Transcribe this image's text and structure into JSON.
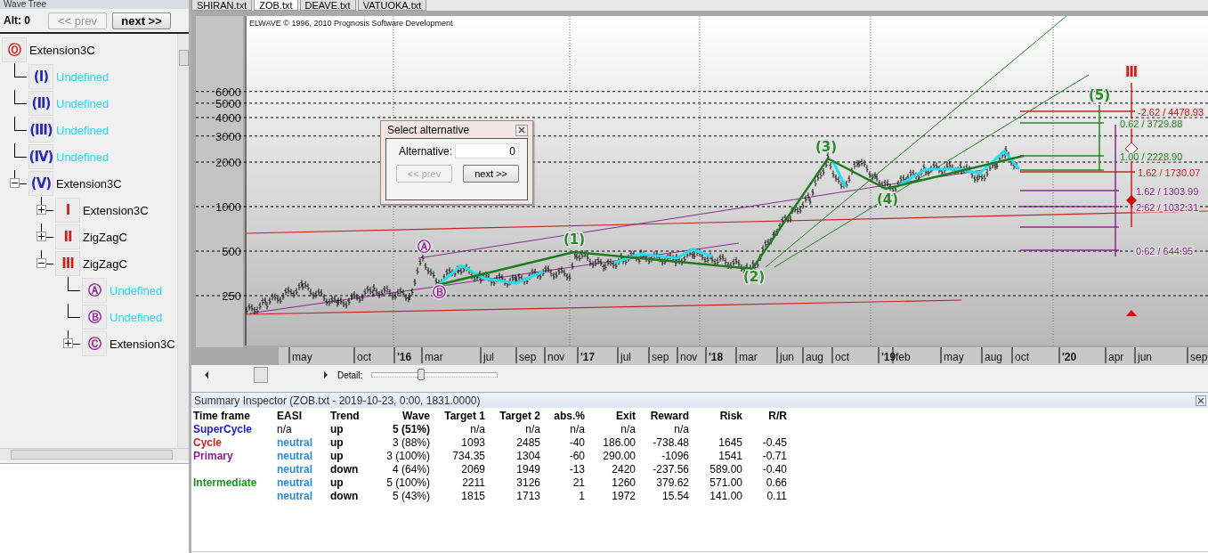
{
  "wave_tree": {
    "title": "Wave Tree",
    "alt_label": "Alt: 0",
    "prev_button": {
      "label": "<< prev",
      "disabled": true
    },
    "next_button": {
      "label": "next >>",
      "disabled": false
    },
    "nodes": [
      {
        "symbol": "Ⓞ",
        "color": "#cc2222",
        "label": "Extension3C",
        "defined": true,
        "children": [
          {
            "symbol": "(I)",
            "color": "#2a2ab0",
            "label": "Undefined",
            "defined": false
          },
          {
            "symbol": "(II)",
            "color": "#2a2ab0",
            "label": "Undefined",
            "defined": false
          },
          {
            "symbol": "(III)",
            "color": "#2a2ab0",
            "label": "Undefined",
            "defined": false
          },
          {
            "symbol": "(IV)",
            "color": "#2a2ab0",
            "label": "Undefined",
            "defined": false
          },
          {
            "symbol": "(V)",
            "color": "#2a2ab0",
            "label": "Extension3C",
            "defined": true,
            "expanded": true,
            "children": [
              {
                "symbol": "I",
                "color": "#cc2222",
                "label": "Extension3C",
                "defined": true,
                "expanded": false
              },
              {
                "symbol": "II",
                "color": "#cc2222",
                "label": "ZigZagC",
                "defined": true,
                "expanded": false
              },
              {
                "symbol": "III",
                "color": "#cc2222",
                "label": "ZigZagC",
                "defined": true,
                "expanded": true,
                "children": [
                  {
                    "symbol": "Ⓐ",
                    "color": "#9a2a9a",
                    "label": "Undefined",
                    "defined": false
                  },
                  {
                    "symbol": "Ⓑ",
                    "color": "#9a2a9a",
                    "label": "Undefined",
                    "defined": false
                  },
                  {
                    "symbol": "Ⓒ",
                    "color": "#9a2a9a",
                    "label": "Extension3C",
                    "defined": true,
                    "expanded": false
                  }
                ]
              }
            ]
          }
        ]
      }
    ]
  },
  "tabs": [
    {
      "label": "SHIRAN.txt",
      "selected": false
    },
    {
      "label": "ZOB.txt",
      "selected": true
    },
    {
      "label": "DEAVE.txt",
      "selected": false
    },
    {
      "label": "VATUOKA.txt",
      "selected": false
    }
  ],
  "chart": {
    "copyright": "ELWAVE © 1996, 2010 Prognosis Software Development",
    "y_labels": [
      "6000",
      "5000",
      "4000",
      "3000",
      "2000",
      "1000",
      "500",
      "250"
    ],
    "x_labels": [
      {
        "text": "may",
        "kind": "month"
      },
      {
        "text": "oct",
        "kind": "month"
      },
      {
        "text": "'16",
        "kind": "year"
      },
      {
        "text": "mar",
        "kind": "month"
      },
      {
        "text": "jul",
        "kind": "month"
      },
      {
        "text": "sep",
        "kind": "month"
      },
      {
        "text": "nov",
        "kind": "month"
      },
      {
        "text": "'17",
        "kind": "year"
      },
      {
        "text": "jul",
        "kind": "month"
      },
      {
        "text": "sep",
        "kind": "month"
      },
      {
        "text": "nov",
        "kind": "month"
      },
      {
        "text": "'18",
        "kind": "year"
      },
      {
        "text": "mar",
        "kind": "month"
      },
      {
        "text": "jun",
        "kind": "month"
      },
      {
        "text": "aug",
        "kind": "month"
      },
      {
        "text": "oct",
        "kind": "month"
      },
      {
        "text": "'19",
        "kind": "year"
      },
      {
        "text": "feb",
        "kind": "month"
      },
      {
        "text": "may",
        "kind": "month"
      },
      {
        "text": "aug",
        "kind": "month"
      },
      {
        "text": "oct",
        "kind": "month"
      },
      {
        "text": "'20",
        "kind": "year"
      },
      {
        "text": "apr",
        "kind": "month"
      },
      {
        "text": "jun",
        "kind": "month"
      },
      {
        "text": "sep",
        "kind": "month"
      }
    ],
    "wave_labels": [
      {
        "text": "Ⓐ",
        "color": "#9a2a9a"
      },
      {
        "text": "Ⓑ",
        "color": "#9a2a9a"
      },
      {
        "text": "(1)",
        "color": "#2a8a2a"
      },
      {
        "text": "(2)",
        "color": "#2a8a2a"
      },
      {
        "text": "(3)",
        "color": "#2a8a2a"
      },
      {
        "text": "(4)",
        "color": "#2a8a2a"
      },
      {
        "text": "(5)",
        "color": "#2a8a2a"
      },
      {
        "text": "Ⅲ",
        "color": "#cc2222"
      }
    ],
    "fib_labels": [
      {
        "text": "-2.62 / 4478.93",
        "color": "#cc2222"
      },
      {
        "text": "0.62 / 3729.88",
        "color": "#2a8a2a"
      },
      {
        "text": "1.00 / 2228.90",
        "color": "#2a8a2a"
      },
      {
        "text": "1.62 / 1730.07",
        "color": "#cc2222"
      },
      {
        "text": "1.62 / 1303.99",
        "color": "#8a2a8a"
      },
      {
        "text": "2.62 / 1032.31",
        "color": "#8a2a8a"
      },
      {
        "text": "0.62 / 644.95",
        "color": "#8a2a8a"
      }
    ]
  },
  "dialog": {
    "title": "Select alternative",
    "field_label": "Alternative:",
    "value": "0",
    "prev_button": {
      "label": "<< prev",
      "disabled": true
    },
    "next_button": {
      "label": "next >>",
      "disabled": false
    }
  },
  "detail_slider": {
    "label": "Detail:",
    "level": 0.38
  },
  "summary": {
    "title": "Summary Inspector (ZOB.txt - 2019-10-23, 0:00, 1831.0000)",
    "columns": [
      "Time frame",
      "EASI",
      "Trend",
      "Wave",
      "Target 1",
      "Target 2",
      "abs.%",
      "Exit",
      "Reward",
      "Risk",
      "R/R"
    ],
    "rows": [
      {
        "time_frame": "SuperCycle",
        "color": "#2020c0",
        "easi": "n/a",
        "trend": "up",
        "wave": "5 (51%)",
        "wave_bold": true,
        "target_1": "n/a",
        "target_2": "n/a",
        "abs": "n/a",
        "exit": "n/a",
        "reward": "n/a"
      },
      {
        "time_frame": "Cycle",
        "color": "#cc2020",
        "easi": "neutral",
        "trend": "up",
        "wave": "3 (88%)",
        "wave_bold": false,
        "target_1": "1093",
        "target_2": "2485",
        "abs": "-40",
        "exit": "186.00",
        "reward": "-738.48",
        "risk": "1645",
        "rr": "-0.45"
      },
      {
        "time_frame": "Primary",
        "color": "#8a208a",
        "easi": "neutral",
        "trend": "up",
        "wave": "3 (100%)",
        "wave_bold": false,
        "target_1": "734.35",
        "target_2": "1304",
        "abs": "-60",
        "exit": "290.00",
        "reward": "-1096",
        "risk": "1541",
        "rr": "-0.71"
      },
      {
        "easi": "neutral",
        "trend": "down",
        "wave": "4 (64%)",
        "wave_bold": false,
        "target_1": "2069",
        "target_2": "1949",
        "abs": "-13",
        "exit": "2420",
        "reward": "-237.56",
        "risk": "589.00",
        "rr": "-0.40"
      },
      {
        "time_frame": "Intermediate",
        "color": "#209020",
        "easi": "neutral",
        "trend": "up",
        "wave": "5 (100%)",
        "wave_bold": false,
        "target_1": "2211",
        "target_2": "3126",
        "abs": "21",
        "exit": "1260",
        "reward": "379.62",
        "risk": "571.00",
        "rr": "0.66"
      },
      {
        "easi": "neutral",
        "trend": "down",
        "wave": "5 (43%)",
        "wave_bold": false,
        "target_1": "1815",
        "target_2": "1713",
        "abs": "1",
        "exit": "1972",
        "reward": "15.54",
        "risk": "141.00",
        "rr": "0.11"
      }
    ]
  }
}
